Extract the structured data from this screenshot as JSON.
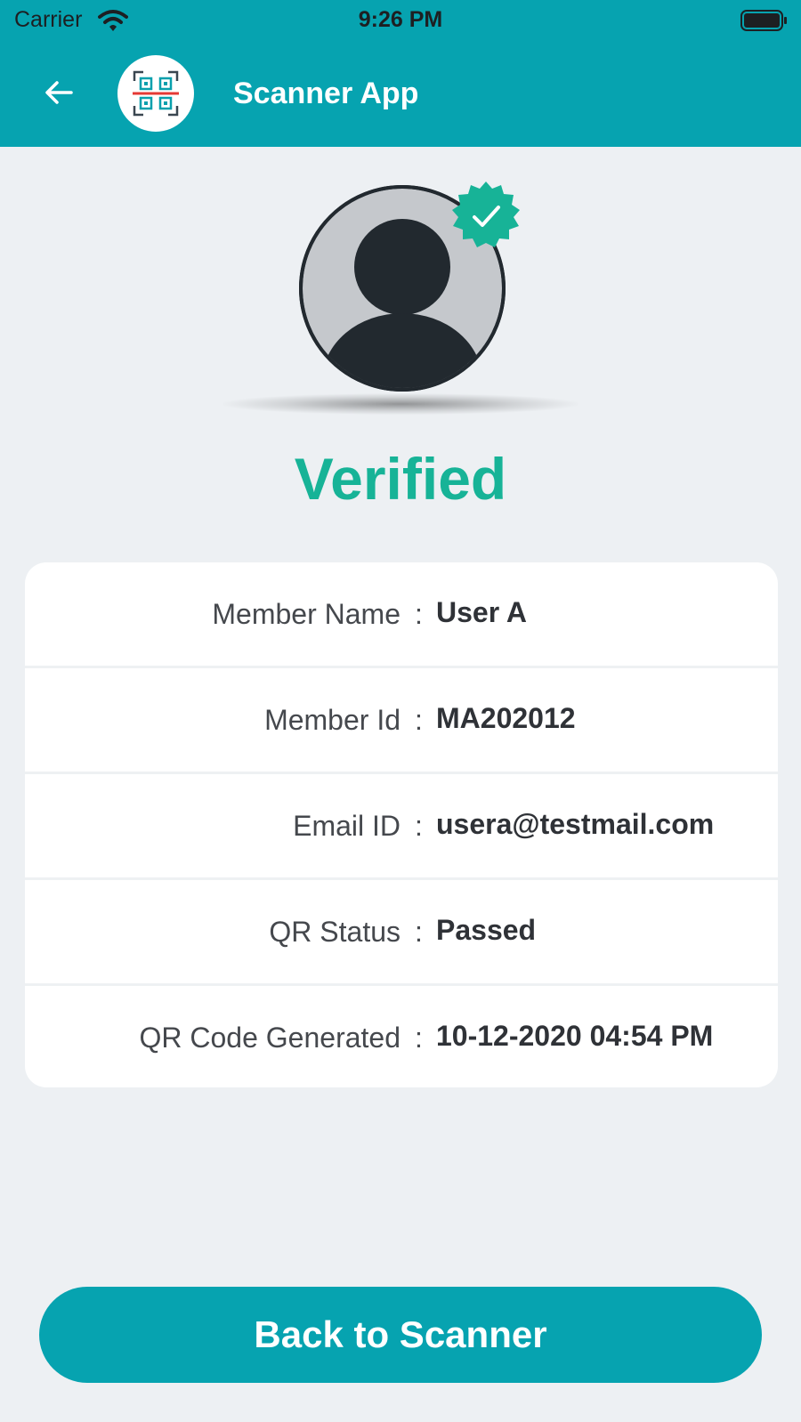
{
  "status_bar": {
    "carrier": "Carrier",
    "time": "9:26 PM"
  },
  "header": {
    "title": "Scanner App"
  },
  "colors": {
    "brand": "#06a3b0",
    "verified": "#17b397",
    "background": "#edf0f3"
  },
  "status": {
    "text": "Verified"
  },
  "details": [
    {
      "label": "Member Name",
      "value": "User A"
    },
    {
      "label": "Member Id",
      "value": "MA202012"
    },
    {
      "label": "Email ID",
      "value": "usera@testmail.com"
    },
    {
      "label": "QR Status",
      "value": "Passed"
    },
    {
      "label": "QR Code Generated",
      "value": "10-12-2020 04:54 PM"
    }
  ],
  "details_separator": ":",
  "actions": {
    "back_label": "Back to Scanner"
  },
  "icons": [
    "wifi-icon",
    "battery-icon",
    "back-arrow-icon",
    "qr-scanner-icon",
    "user-avatar-icon",
    "verified-check-icon"
  ]
}
